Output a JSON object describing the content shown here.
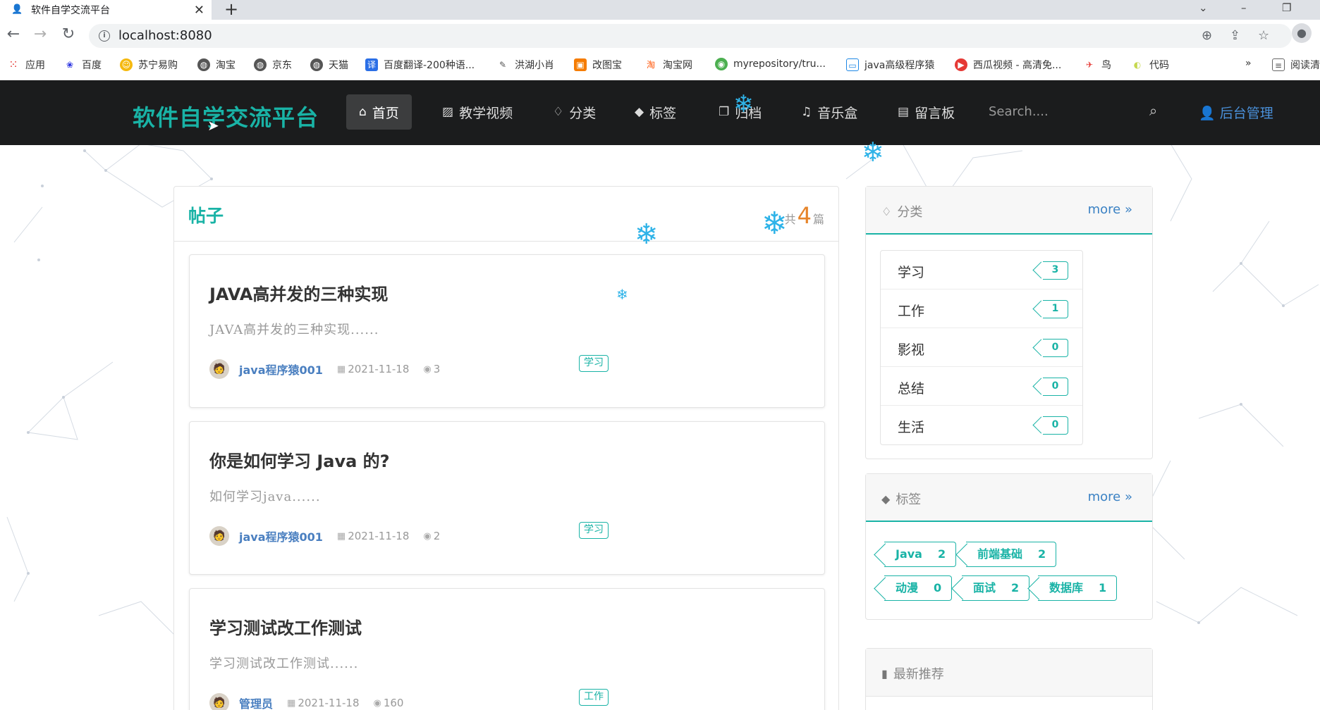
{
  "browser": {
    "tab_title": "软件自学交流平台",
    "url": "localhost:8080",
    "bookmarks": [
      "应用",
      "百度",
      "苏宁易购",
      "淘宝",
      "京东",
      "天猫",
      "百度翻译-200种语...",
      "洪湖小肖",
      "改图宝",
      "淘宝网",
      "myrepository/tru...",
      "java高级程序猿",
      "西瓜视频 - 高清免...",
      "鸟",
      "代码",
      "阅读清"
    ],
    "more_bookmarks": "»"
  },
  "nav": {
    "brand": "软件自学交流平台",
    "items": [
      "首页",
      "教学视频",
      "分类",
      "标签",
      "归档",
      "音乐盒",
      "留言板"
    ],
    "search_placeholder": "Search....",
    "admin": "后台管理"
  },
  "posts": {
    "title": "帖子",
    "count_prefix": "共",
    "count": "4",
    "count_suffix": "篇",
    "items": [
      {
        "title": "JAVA高并发的三种实现",
        "excerpt": "JAVA高并发的三种实现......",
        "author": "java程序猿001",
        "date": "2021-11-18",
        "views": "3",
        "tag": "学习"
      },
      {
        "title": "你是如何学习 Java 的?",
        "excerpt": "如何学习java......",
        "author": "java程序猿001",
        "date": "2021-11-18",
        "views": "2",
        "tag": "学习"
      },
      {
        "title": "学习测试改工作测试",
        "excerpt": "学习测试改工作测试......",
        "author": "管理员",
        "date": "2021-11-18",
        "views": "160",
        "tag": "工作"
      }
    ]
  },
  "categories": {
    "title": "分类",
    "more": "more",
    "items": [
      {
        "name": "学习",
        "count": "3"
      },
      {
        "name": "工作",
        "count": "1"
      },
      {
        "name": "影视",
        "count": "0"
      },
      {
        "name": "总结",
        "count": "0"
      },
      {
        "name": "生活",
        "count": "0"
      }
    ]
  },
  "tags": {
    "title": "标签",
    "more": "more",
    "items": [
      {
        "name": "Java",
        "count": "2"
      },
      {
        "name": "前端基础",
        "count": "2"
      },
      {
        "name": "动漫",
        "count": "0"
      },
      {
        "name": "面试",
        "count": "2"
      },
      {
        "name": "数据库",
        "count": "1"
      }
    ]
  },
  "recommend": {
    "title": "最新推荐"
  },
  "colors": {
    "accent": "#19b3a6",
    "navbar": "#1b1c1d",
    "link": "#3b82c4",
    "count_highlight": "#e6842a"
  }
}
